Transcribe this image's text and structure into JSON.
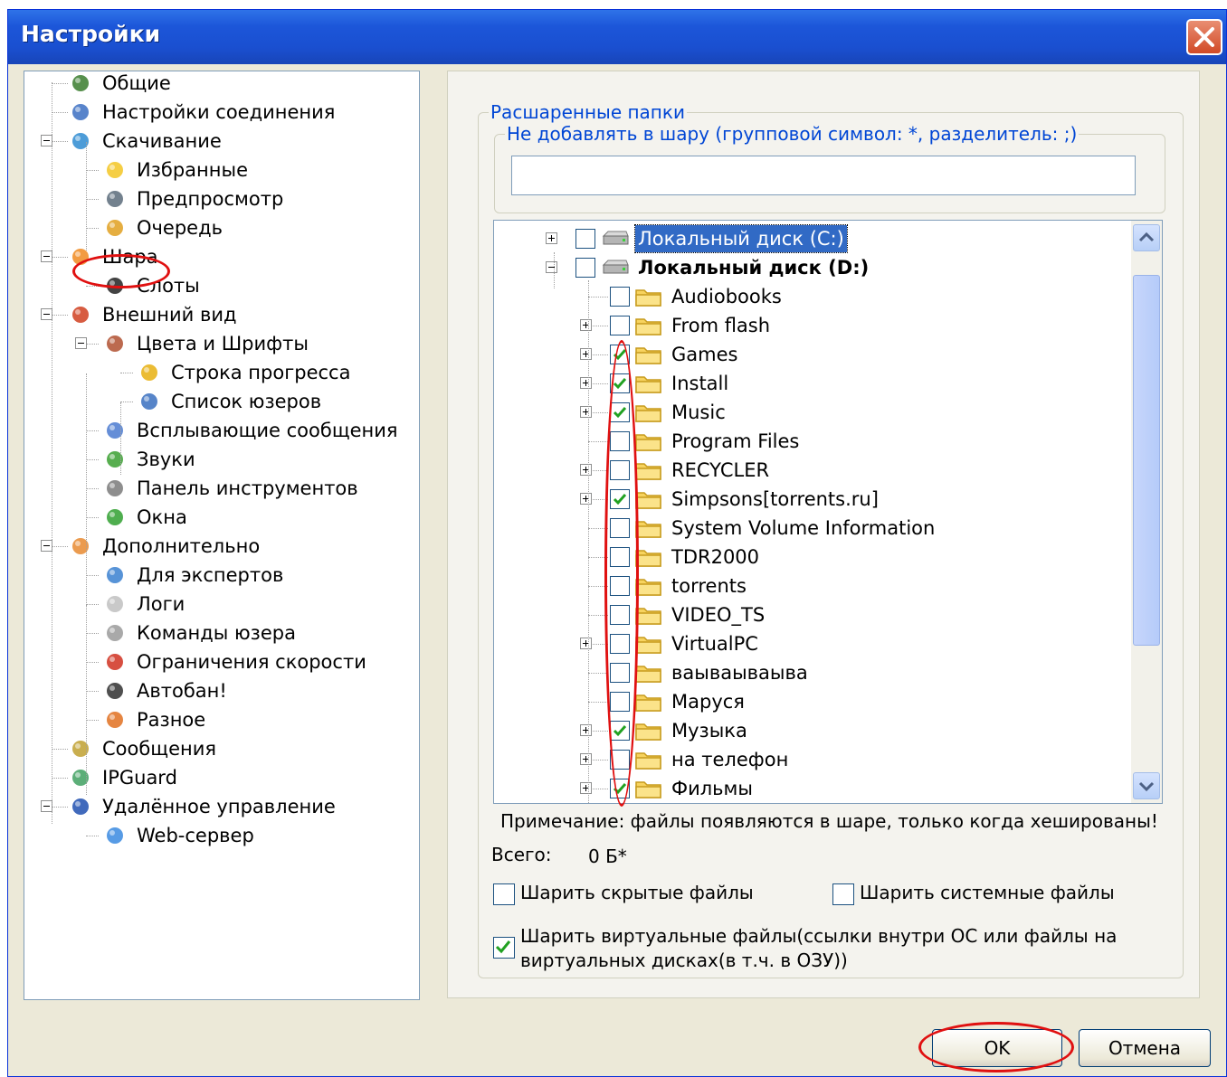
{
  "window": {
    "title": "Настройки"
  },
  "nav": {
    "items": [
      {
        "label": "Общие",
        "icon": "users-icon"
      },
      {
        "label": "Настройки соединения",
        "icon": "network-icon"
      },
      {
        "label": "Скачивание",
        "icon": "globe-download-icon"
      },
      {
        "label": "Избранные",
        "icon": "star-icon"
      },
      {
        "label": "Предпросмотр",
        "icon": "preview-icon"
      },
      {
        "label": "Очередь",
        "icon": "queue-icon"
      },
      {
        "label": "Шара",
        "icon": "share-icon"
      },
      {
        "label": "Слоты",
        "icon": "slots-icon"
      },
      {
        "label": "Внешний вид",
        "icon": "appearance-icon"
      },
      {
        "label": "Цвета и Шрифты",
        "icon": "palette-icon"
      },
      {
        "label": "Строка прогресса",
        "icon": "progress-bar-icon"
      },
      {
        "label": "Список юзеров",
        "icon": "user-list-icon"
      },
      {
        "label": "Всплывающие сообщения",
        "icon": "popup-icon"
      },
      {
        "label": "Звуки",
        "icon": "music-note-icon"
      },
      {
        "label": "Панель инструментов",
        "icon": "tools-icon"
      },
      {
        "label": "Окна",
        "icon": "windows-icon"
      },
      {
        "label": "Дополнительно",
        "icon": "advanced-icon"
      },
      {
        "label": "Для экспертов",
        "icon": "expert-icon"
      },
      {
        "label": "Логи",
        "icon": "logs-icon"
      },
      {
        "label": "Команды юзера",
        "icon": "user-commands-icon"
      },
      {
        "label": "Ограничения скорости",
        "icon": "speed-limit-icon"
      },
      {
        "label": "Автобан!",
        "icon": "autoban-icon"
      },
      {
        "label": "Разное",
        "icon": "misc-icon"
      },
      {
        "label": "Сообщения",
        "icon": "messages-icon"
      },
      {
        "label": "IPGuard",
        "icon": "ipguard-icon"
      },
      {
        "label": "Удалённое управление",
        "icon": "remote-control-icon"
      },
      {
        "label": "Web-сервер",
        "icon": "web-server-icon"
      }
    ]
  },
  "share": {
    "group_title": "Расшаренные папки",
    "exclude_title": "Не добавлять в шару (групповой символ: *, разделитель: ;)",
    "exclude_value": "",
    "drives": [
      {
        "label": "Локальный диск (C:)",
        "checked": false,
        "expanded": false,
        "selected": true
      },
      {
        "label": "Локальный диск (D:)",
        "checked": false,
        "expanded": true,
        "selected": false
      }
    ],
    "folders": [
      {
        "label": "Audiobooks",
        "checked": false,
        "expandable": false
      },
      {
        "label": "From flash",
        "checked": false,
        "expandable": true
      },
      {
        "label": "Games",
        "checked": true,
        "expandable": true
      },
      {
        "label": "Install",
        "checked": true,
        "expandable": true
      },
      {
        "label": "Music",
        "checked": true,
        "expandable": true
      },
      {
        "label": "Program Files",
        "checked": false,
        "expandable": false
      },
      {
        "label": "RECYCLER",
        "checked": false,
        "expandable": true
      },
      {
        "label": "Simpsons[torrents.ru]",
        "checked": true,
        "expandable": true
      },
      {
        "label": "System Volume Information",
        "checked": false,
        "expandable": false
      },
      {
        "label": "TDR2000",
        "checked": false,
        "expandable": false
      },
      {
        "label": "torrents",
        "checked": false,
        "expandable": false
      },
      {
        "label": "VIDEO_TS",
        "checked": false,
        "expandable": false
      },
      {
        "label": "VirtualPC",
        "checked": false,
        "expandable": true
      },
      {
        "label": "ваываываыва",
        "checked": false,
        "expandable": false
      },
      {
        "label": "Маруся",
        "checked": false,
        "expandable": false
      },
      {
        "label": "Музыка",
        "checked": true,
        "expandable": true
      },
      {
        "label": "на телефон",
        "checked": false,
        "expandable": true
      },
      {
        "label": "Фильмы",
        "checked": true,
        "expandable": true
      }
    ],
    "note": "Примечание: файлы появляются в шаре, только когда хешированы!",
    "total_label": "Всего:",
    "total_value": "0 Б*",
    "options": {
      "hidden": {
        "label": "Шарить скрытые файлы",
        "checked": false
      },
      "system": {
        "label": "Шарить системные файлы",
        "checked": false
      },
      "virtual": {
        "label": "Шарить виртуальные файлы(ссылки внутри ОС или файлы на виртуальных дисках(в т.ч. в ОЗУ))",
        "checked": true
      }
    }
  },
  "buttons": {
    "ok": "OK",
    "cancel": "Отмена"
  },
  "colors": {
    "annotation": "#e01010",
    "title_bar": "#1c56d9",
    "legend": "#0046d5",
    "check": "#21a121"
  }
}
